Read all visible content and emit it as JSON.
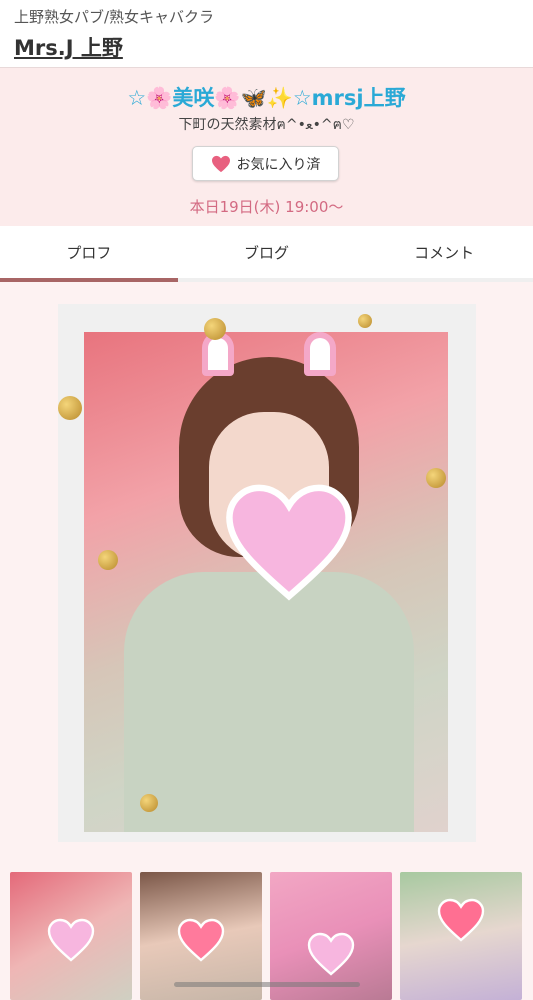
{
  "header": {
    "category": "上野熟女パブ/熟女キャバクラ",
    "shop_name": "Mrs.J 上野"
  },
  "profile": {
    "name": "☆🌸美咲🌸🦋✨☆mrsj上野",
    "catchphrase": "下町の天然素材ฅ^•ﻌ•^ฅ♡",
    "favorite_button_label": "お気に入り済",
    "schedule": "本日19日(木) 19:00〜"
  },
  "tabs": [
    {
      "label": "プロフ",
      "active": true
    },
    {
      "label": "ブログ",
      "active": false
    },
    {
      "label": "コメント",
      "active": false
    }
  ],
  "colors": {
    "accent_pink": "#d36a82",
    "name_blue": "#2aa9d6",
    "tab_indicator": "#a86565",
    "profile_bg": "#fcebeb"
  },
  "icons": {
    "favorite": "heart-icon"
  }
}
